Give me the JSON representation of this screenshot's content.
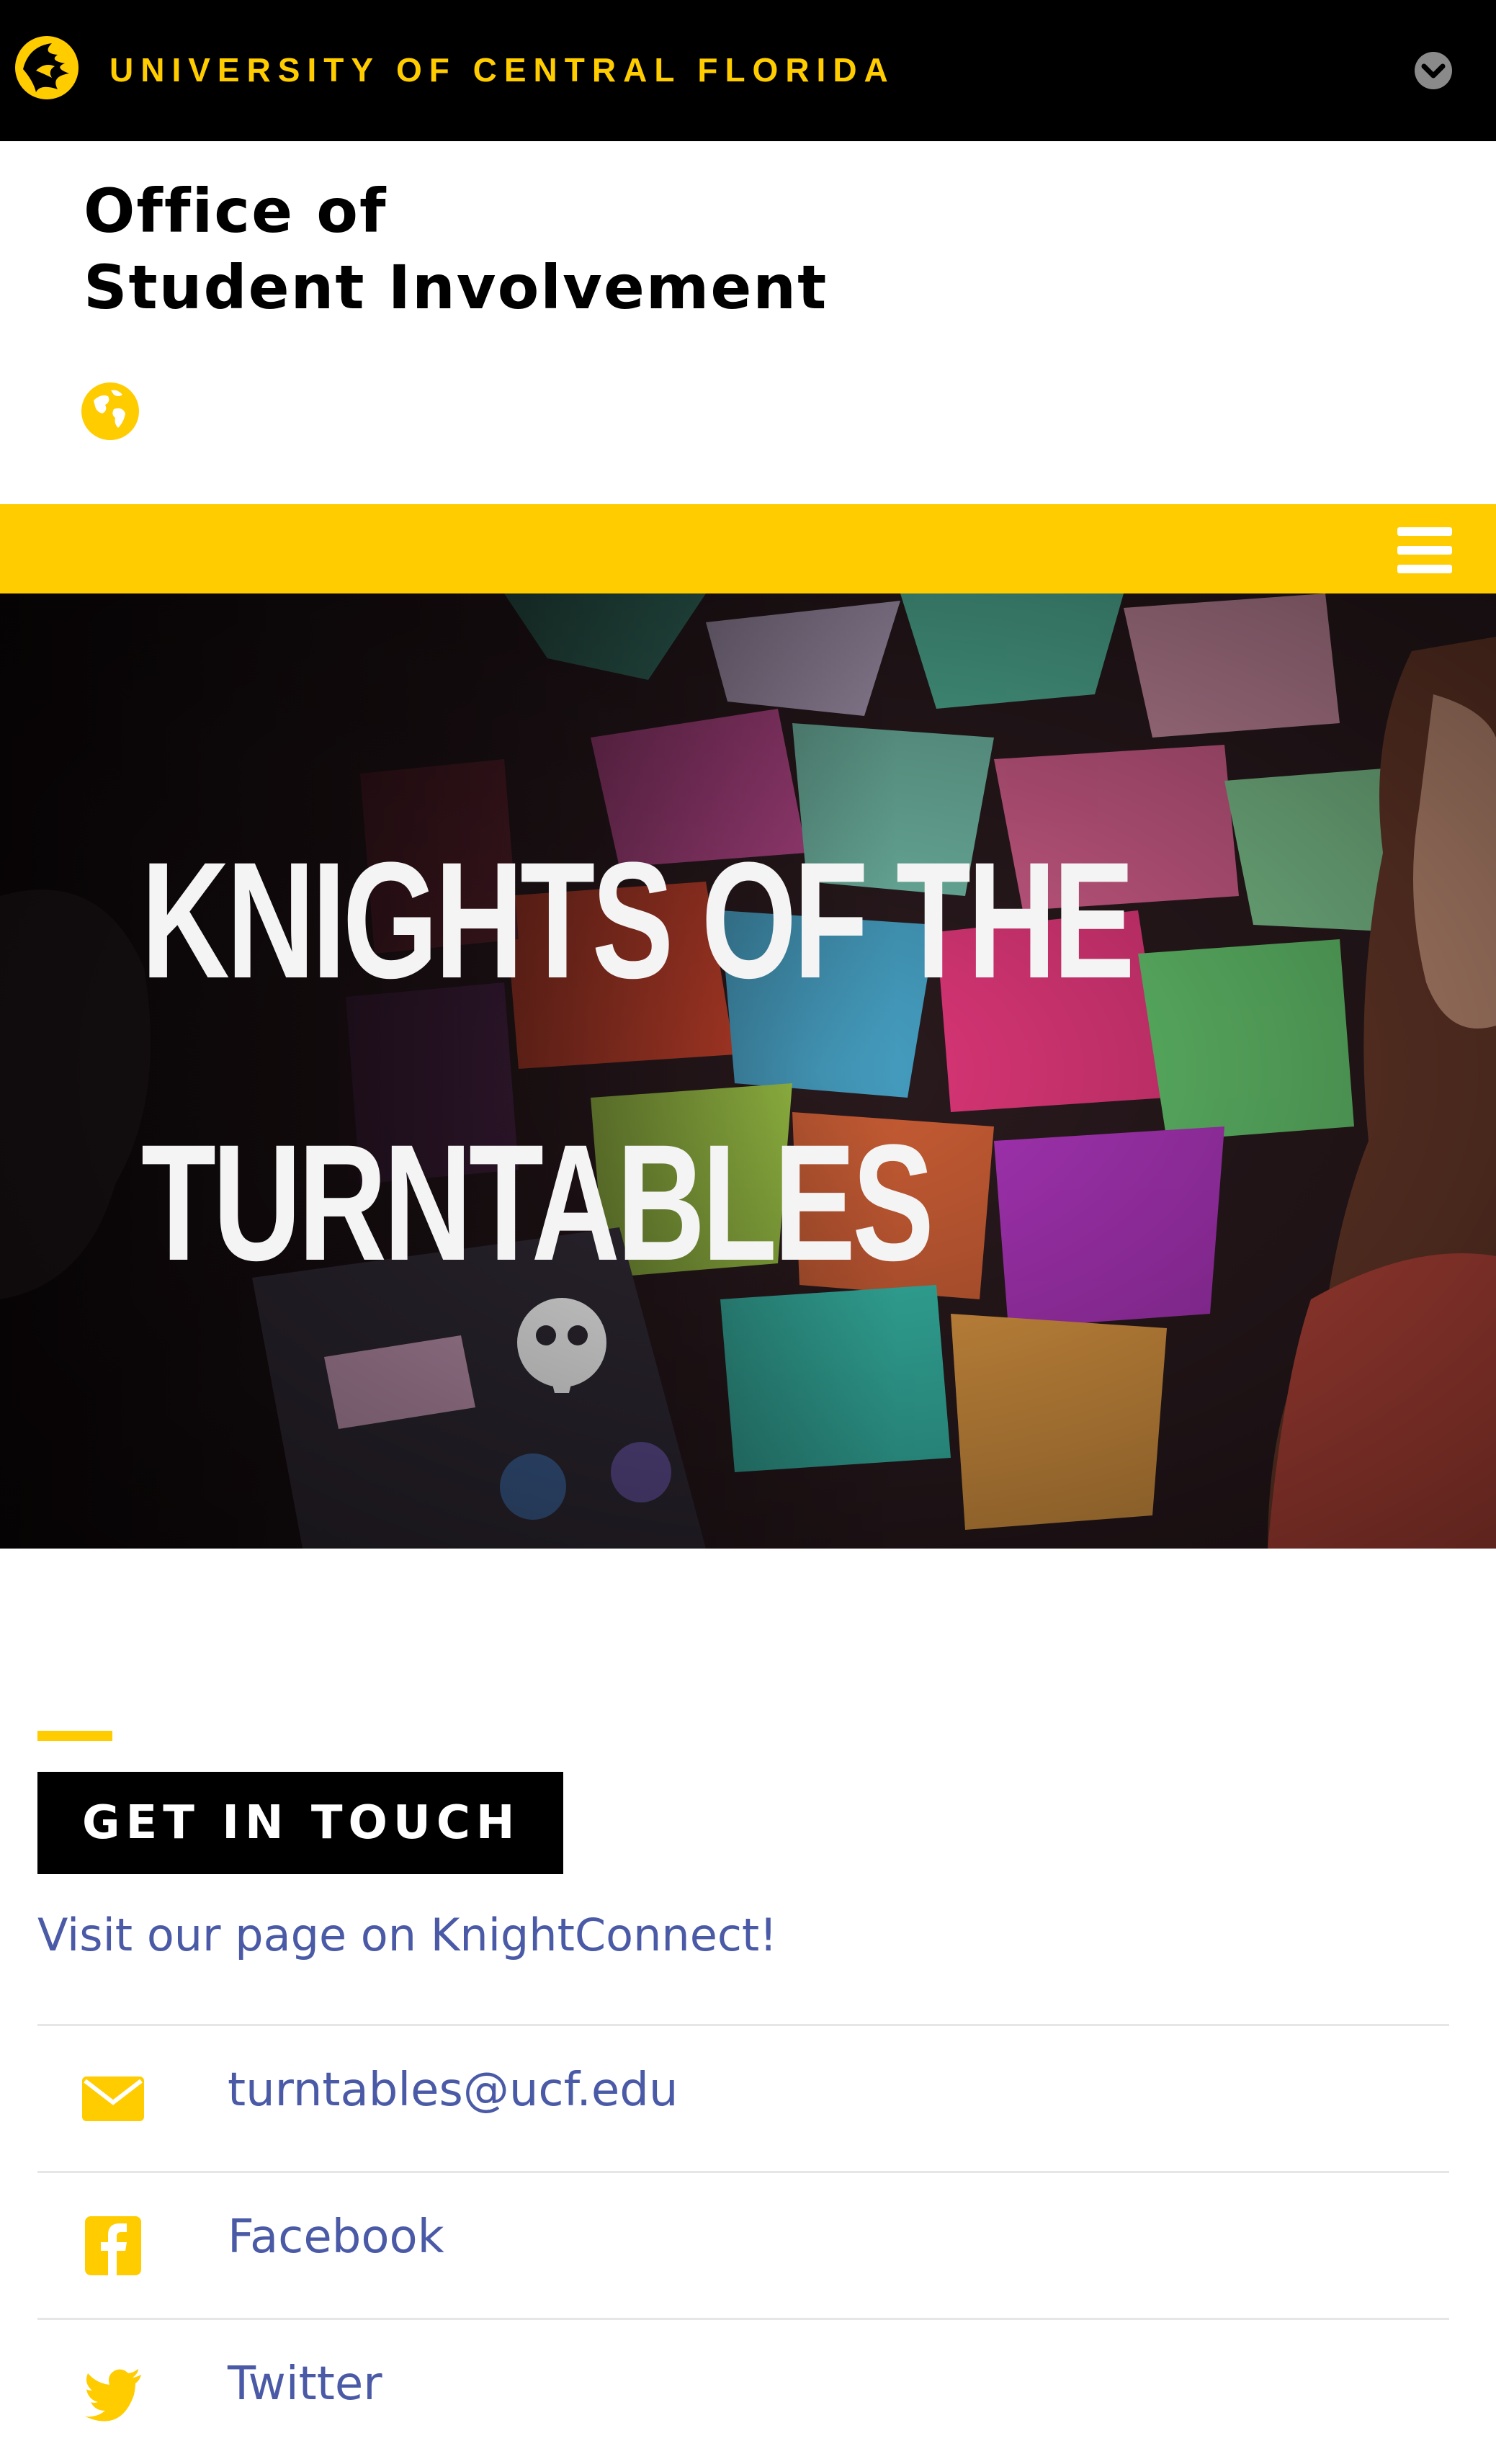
{
  "topbar": {
    "university_name": "UNIVERSITY OF CENTRAL FLORIDA",
    "logo_icon": "pegasus-logo-icon",
    "toggle_icon": "chevron-down-circle-icon"
  },
  "site": {
    "title_line1": "Office of",
    "title_line2": "Student Involvement",
    "globe_icon": "globe-icon"
  },
  "nav": {
    "menu_icon": "hamburger-menu-icon"
  },
  "hero": {
    "title_line1": "KNIGHTS OF THE",
    "title_line2": "TURNTABLES"
  },
  "contact": {
    "heading": "GET IN TOUCH",
    "knightconnect_link": "Visit our page on KnightConnect!",
    "items": [
      {
        "icon": "envelope-icon",
        "label": "turntables@ucf.edu"
      },
      {
        "icon": "facebook-icon",
        "label": "Facebook"
      },
      {
        "icon": "twitter-icon",
        "label": "Twitter"
      }
    ]
  },
  "colors": {
    "brand_gold": "#ffcc00",
    "black": "#000000",
    "link_blue": "#4a5aa6"
  }
}
